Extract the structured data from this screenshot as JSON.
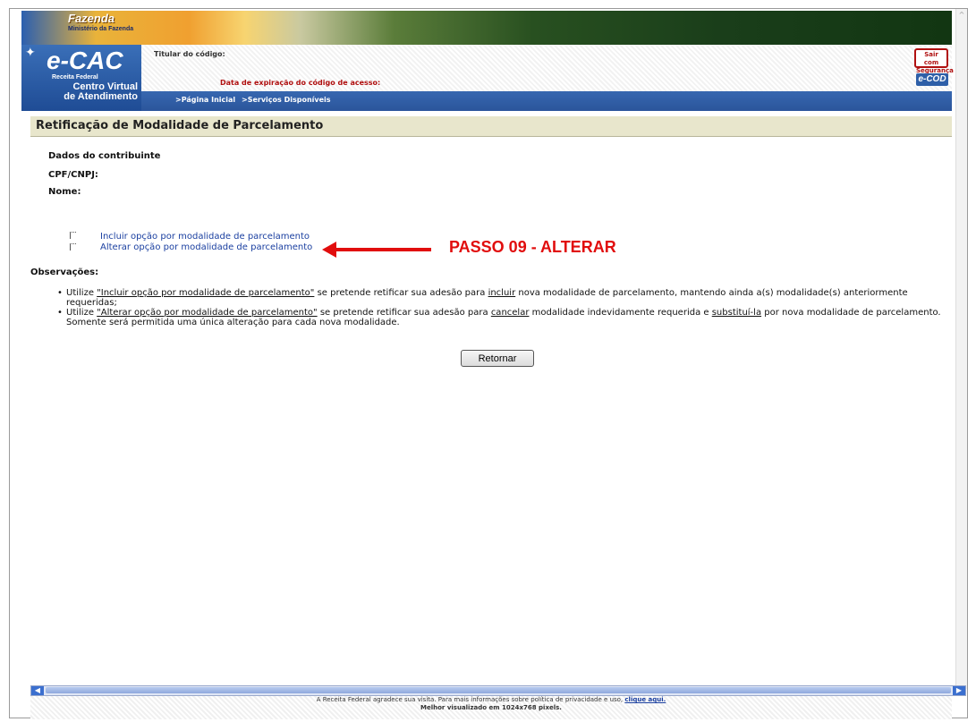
{
  "header": {
    "fazenda": "Fazenda",
    "ministerio": "Ministério da Fazenda",
    "logo_main": "e-CAC",
    "logo_receita": "Receita Federal",
    "logo_centro": "Centro Virtual",
    "logo_atendimento": "de Atendimento",
    "titular_label": "Titular do código:",
    "expiracao_label": "Data de expiração do código de acesso:",
    "sair_label_1": "Sair com",
    "sair_label_2": "Segurança",
    "ecod_label": "e-COD",
    "nav": {
      "pagina_inicial": ">Página Inicial",
      "servicos": ">Serviços Disponíveis"
    }
  },
  "main": {
    "title": "Retificação de Modalidade de Parcelamento",
    "dados_label": "Dados do contribuinte",
    "cpf_label": "CPF/CNPJ:",
    "nome_label": "Nome:",
    "options": {
      "incluir": "Incluir opção por modalidade de parcelamento",
      "alterar": "Alterar opção por modalidade de parcelamento"
    },
    "annotation": "PASSO 09 - ALTERAR",
    "observacoes_label": "Observações:",
    "obs": {
      "item1_a": "Utilize ",
      "item1_link": "\"Incluir opção por modalidade de parcelamento\"",
      "item1_b": " se pretende retificar sua adesão para ",
      "item1_u": "incluir",
      "item1_c": " nova modalidade de parcelamento, mantendo ainda a(s) modalidade(s) anteriormente requeridas;",
      "item2_a": "Utilize ",
      "item2_link": "\"Alterar opção por modalidade de parcelamento\"",
      "item2_b": " se pretende retificar sua adesão para ",
      "item2_u1": "cancelar",
      "item2_c": " modalidade indevidamente requerida e ",
      "item2_u2": "substituí-la",
      "item2_d": " por nova modalidade de parcelamento. Somente será permitida uma única alteração para cada nova modalidade."
    },
    "retornar_label": "Retornar"
  },
  "footer": {
    "line1_a": "A Receita Federal agradece sua visita. Para mais informações sobre política de privacidade e uso, ",
    "line1_link": "clique aqui.",
    "line2": "Melhor visualizado em 1024x768 pixels."
  },
  "colors": {
    "annotation": "#e10d0d",
    "title_bg": "#e8e6cc",
    "nav_bg": "#2b559b",
    "link": "#1a3fa0"
  }
}
